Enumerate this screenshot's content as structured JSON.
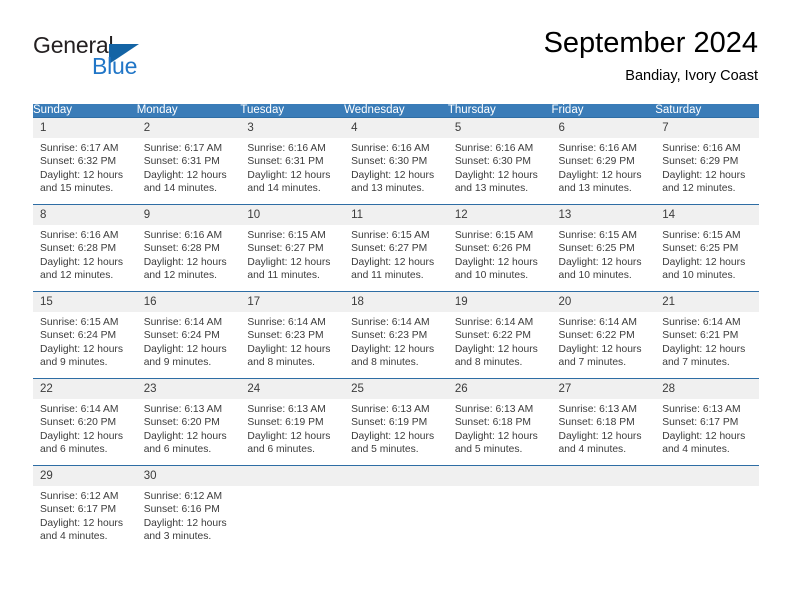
{
  "brand": {
    "name_top": "General",
    "name_bottom": "Blue",
    "triangle_color": "#1464a5",
    "blue_text_color": "#2176c7"
  },
  "header": {
    "title": "September 2024",
    "subtitle": "Bandiay, Ivory Coast"
  },
  "theme": {
    "header_row_bg": "#3a7cb8",
    "week_divider": "#2e6da4",
    "daynum_bg": "#f0f0f0",
    "text": "#3c3c3c"
  },
  "calendar": {
    "weekday_headers": [
      "Sunday",
      "Monday",
      "Tuesday",
      "Wednesday",
      "Thursday",
      "Friday",
      "Saturday"
    ],
    "weeks": [
      [
        {
          "day": "1",
          "sunrise": "Sunrise: 6:17 AM",
          "sunset": "Sunset: 6:32 PM",
          "daylight": "Daylight: 12 hours and 15 minutes."
        },
        {
          "day": "2",
          "sunrise": "Sunrise: 6:17 AM",
          "sunset": "Sunset: 6:31 PM",
          "daylight": "Daylight: 12 hours and 14 minutes."
        },
        {
          "day": "3",
          "sunrise": "Sunrise: 6:16 AM",
          "sunset": "Sunset: 6:31 PM",
          "daylight": "Daylight: 12 hours and 14 minutes."
        },
        {
          "day": "4",
          "sunrise": "Sunrise: 6:16 AM",
          "sunset": "Sunset: 6:30 PM",
          "daylight": "Daylight: 12 hours and 13 minutes."
        },
        {
          "day": "5",
          "sunrise": "Sunrise: 6:16 AM",
          "sunset": "Sunset: 6:30 PM",
          "daylight": "Daylight: 12 hours and 13 minutes."
        },
        {
          "day": "6",
          "sunrise": "Sunrise: 6:16 AM",
          "sunset": "Sunset: 6:29 PM",
          "daylight": "Daylight: 12 hours and 13 minutes."
        },
        {
          "day": "7",
          "sunrise": "Sunrise: 6:16 AM",
          "sunset": "Sunset: 6:29 PM",
          "daylight": "Daylight: 12 hours and 12 minutes."
        }
      ],
      [
        {
          "day": "8",
          "sunrise": "Sunrise: 6:16 AM",
          "sunset": "Sunset: 6:28 PM",
          "daylight": "Daylight: 12 hours and 12 minutes."
        },
        {
          "day": "9",
          "sunrise": "Sunrise: 6:16 AM",
          "sunset": "Sunset: 6:28 PM",
          "daylight": "Daylight: 12 hours and 12 minutes."
        },
        {
          "day": "10",
          "sunrise": "Sunrise: 6:15 AM",
          "sunset": "Sunset: 6:27 PM",
          "daylight": "Daylight: 12 hours and 11 minutes."
        },
        {
          "day": "11",
          "sunrise": "Sunrise: 6:15 AM",
          "sunset": "Sunset: 6:27 PM",
          "daylight": "Daylight: 12 hours and 11 minutes."
        },
        {
          "day": "12",
          "sunrise": "Sunrise: 6:15 AM",
          "sunset": "Sunset: 6:26 PM",
          "daylight": "Daylight: 12 hours and 10 minutes."
        },
        {
          "day": "13",
          "sunrise": "Sunrise: 6:15 AM",
          "sunset": "Sunset: 6:25 PM",
          "daylight": "Daylight: 12 hours and 10 minutes."
        },
        {
          "day": "14",
          "sunrise": "Sunrise: 6:15 AM",
          "sunset": "Sunset: 6:25 PM",
          "daylight": "Daylight: 12 hours and 10 minutes."
        }
      ],
      [
        {
          "day": "15",
          "sunrise": "Sunrise: 6:15 AM",
          "sunset": "Sunset: 6:24 PM",
          "daylight": "Daylight: 12 hours and 9 minutes."
        },
        {
          "day": "16",
          "sunrise": "Sunrise: 6:14 AM",
          "sunset": "Sunset: 6:24 PM",
          "daylight": "Daylight: 12 hours and 9 minutes."
        },
        {
          "day": "17",
          "sunrise": "Sunrise: 6:14 AM",
          "sunset": "Sunset: 6:23 PM",
          "daylight": "Daylight: 12 hours and 8 minutes."
        },
        {
          "day": "18",
          "sunrise": "Sunrise: 6:14 AM",
          "sunset": "Sunset: 6:23 PM",
          "daylight": "Daylight: 12 hours and 8 minutes."
        },
        {
          "day": "19",
          "sunrise": "Sunrise: 6:14 AM",
          "sunset": "Sunset: 6:22 PM",
          "daylight": "Daylight: 12 hours and 8 minutes."
        },
        {
          "day": "20",
          "sunrise": "Sunrise: 6:14 AM",
          "sunset": "Sunset: 6:22 PM",
          "daylight": "Daylight: 12 hours and 7 minutes."
        },
        {
          "day": "21",
          "sunrise": "Sunrise: 6:14 AM",
          "sunset": "Sunset: 6:21 PM",
          "daylight": "Daylight: 12 hours and 7 minutes."
        }
      ],
      [
        {
          "day": "22",
          "sunrise": "Sunrise: 6:14 AM",
          "sunset": "Sunset: 6:20 PM",
          "daylight": "Daylight: 12 hours and 6 minutes."
        },
        {
          "day": "23",
          "sunrise": "Sunrise: 6:13 AM",
          "sunset": "Sunset: 6:20 PM",
          "daylight": "Daylight: 12 hours and 6 minutes."
        },
        {
          "day": "24",
          "sunrise": "Sunrise: 6:13 AM",
          "sunset": "Sunset: 6:19 PM",
          "daylight": "Daylight: 12 hours and 6 minutes."
        },
        {
          "day": "25",
          "sunrise": "Sunrise: 6:13 AM",
          "sunset": "Sunset: 6:19 PM",
          "daylight": "Daylight: 12 hours and 5 minutes."
        },
        {
          "day": "26",
          "sunrise": "Sunrise: 6:13 AM",
          "sunset": "Sunset: 6:18 PM",
          "daylight": "Daylight: 12 hours and 5 minutes."
        },
        {
          "day": "27",
          "sunrise": "Sunrise: 6:13 AM",
          "sunset": "Sunset: 6:18 PM",
          "daylight": "Daylight: 12 hours and 4 minutes."
        },
        {
          "day": "28",
          "sunrise": "Sunrise: 6:13 AM",
          "sunset": "Sunset: 6:17 PM",
          "daylight": "Daylight: 12 hours and 4 minutes."
        }
      ],
      [
        {
          "day": "29",
          "sunrise": "Sunrise: 6:12 AM",
          "sunset": "Sunset: 6:17 PM",
          "daylight": "Daylight: 12 hours and 4 minutes."
        },
        {
          "day": "30",
          "sunrise": "Sunrise: 6:12 AM",
          "sunset": "Sunset: 6:16 PM",
          "daylight": "Daylight: 12 hours and 3 minutes."
        },
        {
          "day": "",
          "sunrise": "",
          "sunset": "",
          "daylight": ""
        },
        {
          "day": "",
          "sunrise": "",
          "sunset": "",
          "daylight": ""
        },
        {
          "day": "",
          "sunrise": "",
          "sunset": "",
          "daylight": ""
        },
        {
          "day": "",
          "sunrise": "",
          "sunset": "",
          "daylight": ""
        },
        {
          "day": "",
          "sunrise": "",
          "sunset": "",
          "daylight": ""
        }
      ]
    ]
  }
}
